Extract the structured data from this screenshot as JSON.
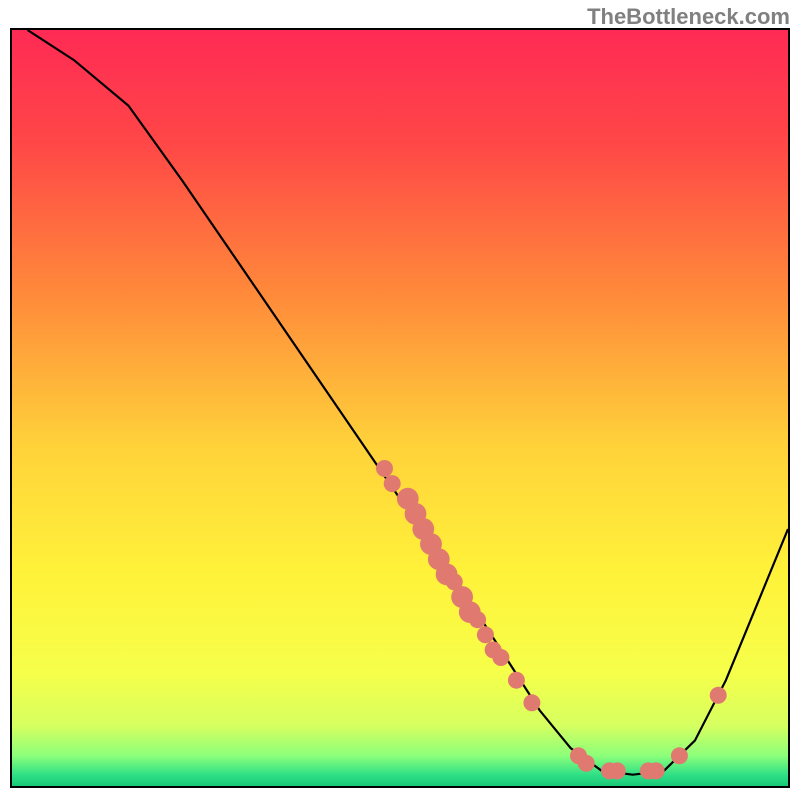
{
  "watermark": "TheBottleneck.com",
  "chart_data": {
    "type": "line",
    "title": "",
    "xlabel": "",
    "ylabel": "",
    "xlim": [
      0,
      100
    ],
    "ylim": [
      0,
      100
    ],
    "gradient_stops": [
      {
        "pos": 0.0,
        "color": "#ff2a55"
      },
      {
        "pos": 0.15,
        "color": "#ff4747"
      },
      {
        "pos": 0.35,
        "color": "#ff8a3a"
      },
      {
        "pos": 0.55,
        "color": "#ffd23a"
      },
      {
        "pos": 0.72,
        "color": "#fff23a"
      },
      {
        "pos": 0.85,
        "color": "#f6ff4a"
      },
      {
        "pos": 0.92,
        "color": "#d6ff60"
      },
      {
        "pos": 0.96,
        "color": "#8cff7a"
      },
      {
        "pos": 0.985,
        "color": "#30e086"
      },
      {
        "pos": 1.0,
        "color": "#18c878"
      }
    ],
    "curve": [
      {
        "x": 2,
        "y": 100
      },
      {
        "x": 8,
        "y": 96
      },
      {
        "x": 15,
        "y": 90
      },
      {
        "x": 22,
        "y": 80
      },
      {
        "x": 30,
        "y": 68
      },
      {
        "x": 38,
        "y": 56
      },
      {
        "x": 46,
        "y": 44
      },
      {
        "x": 52,
        "y": 35
      },
      {
        "x": 58,
        "y": 26
      },
      {
        "x": 63,
        "y": 18
      },
      {
        "x": 68,
        "y": 10
      },
      {
        "x": 72,
        "y": 5
      },
      {
        "x": 76,
        "y": 2
      },
      {
        "x": 80,
        "y": 1.5
      },
      {
        "x": 84,
        "y": 2
      },
      {
        "x": 88,
        "y": 6
      },
      {
        "x": 92,
        "y": 14
      },
      {
        "x": 96,
        "y": 24
      },
      {
        "x": 100,
        "y": 34
      }
    ],
    "markers": [
      {
        "x": 48,
        "y": 42,
        "r": 1.1
      },
      {
        "x": 49,
        "y": 40,
        "r": 1.1
      },
      {
        "x": 51,
        "y": 38,
        "r": 1.4
      },
      {
        "x": 52,
        "y": 36,
        "r": 1.4
      },
      {
        "x": 53,
        "y": 34,
        "r": 1.4
      },
      {
        "x": 54,
        "y": 32,
        "r": 1.4
      },
      {
        "x": 55,
        "y": 30,
        "r": 1.4
      },
      {
        "x": 56,
        "y": 28,
        "r": 1.4
      },
      {
        "x": 57,
        "y": 27,
        "r": 1.1
      },
      {
        "x": 58,
        "y": 25,
        "r": 1.4
      },
      {
        "x": 59,
        "y": 23,
        "r": 1.4
      },
      {
        "x": 60,
        "y": 22,
        "r": 1.1
      },
      {
        "x": 61,
        "y": 20,
        "r": 1.1
      },
      {
        "x": 62,
        "y": 18,
        "r": 1.1
      },
      {
        "x": 63,
        "y": 17,
        "r": 1.1
      },
      {
        "x": 65,
        "y": 14,
        "r": 1.1
      },
      {
        "x": 67,
        "y": 11,
        "r": 1.1
      },
      {
        "x": 73,
        "y": 4,
        "r": 1.1
      },
      {
        "x": 74,
        "y": 3,
        "r": 1.1
      },
      {
        "x": 77,
        "y": 2,
        "r": 1.1
      },
      {
        "x": 78,
        "y": 2,
        "r": 1.1
      },
      {
        "x": 82,
        "y": 2,
        "r": 1.1
      },
      {
        "x": 83,
        "y": 2,
        "r": 1.1
      },
      {
        "x": 86,
        "y": 4,
        "r": 1.1
      },
      {
        "x": 91,
        "y": 12,
        "r": 1.1
      }
    ]
  }
}
